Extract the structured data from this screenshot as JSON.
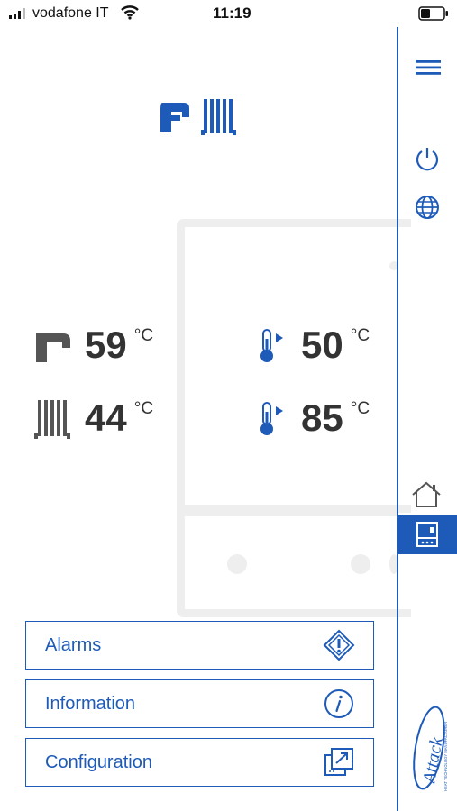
{
  "status_bar": {
    "carrier": "vodafone IT",
    "time": "11:19"
  },
  "sidebar": {
    "items": [
      {
        "icon": "menu-icon"
      },
      {
        "icon": "power-icon"
      },
      {
        "icon": "globe-icon"
      },
      {
        "icon": "home-icon"
      },
      {
        "icon": "boiler-icon",
        "active": true
      }
    ]
  },
  "header": {
    "icon": "tap-radiator-icon"
  },
  "readings": {
    "dhw_temp": {
      "icon": "tap-icon",
      "value": "59",
      "unit": "°C"
    },
    "heating_temp": {
      "icon": "radiator-icon",
      "value": "44",
      "unit": "°C"
    },
    "setpoint_1": {
      "icon": "thermometer-icon",
      "value": "50",
      "unit": "°C"
    },
    "setpoint_2": {
      "icon": "thermometer-icon",
      "value": "85",
      "unit": "°C"
    }
  },
  "buttons": {
    "alarms": "Alarms",
    "information": "Information",
    "configuration": "Configuration"
  },
  "brand": {
    "name": "Attack",
    "tagline": "HEAT TECHNOLOGY MANUFACTURER"
  },
  "colors": {
    "accent": "#1e5bb8",
    "text": "#333333",
    "outline": "#eeeeee"
  }
}
